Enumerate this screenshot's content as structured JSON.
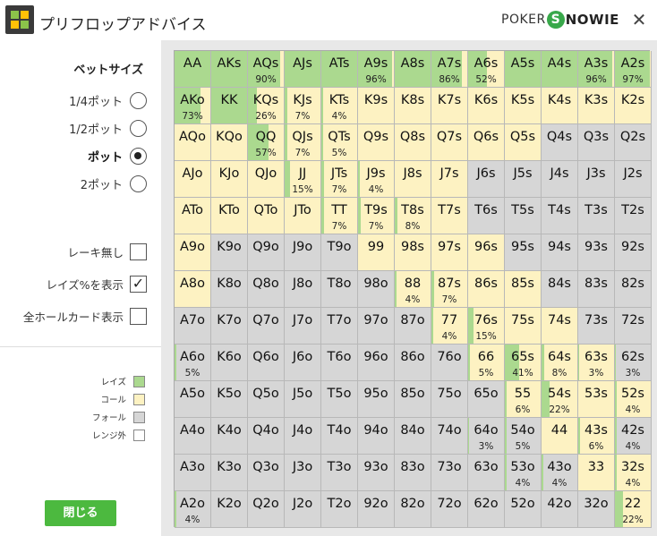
{
  "window": {
    "title": "プリフロップアドバイス",
    "close_glyph": "✕"
  },
  "brand": {
    "poker": "POKER",
    "s": "S",
    "rest": "NOWIE"
  },
  "bet_size": {
    "heading": "ベットサイズ",
    "options": [
      {
        "label": "1/4ポット",
        "selected": false
      },
      {
        "label": "1/2ポット",
        "selected": false
      },
      {
        "label": "ポット",
        "selected": true
      },
      {
        "label": "2ポット",
        "selected": false
      }
    ]
  },
  "options": [
    {
      "label": "レーキ無し",
      "checked": false
    },
    {
      "label": "レイズ%を表示",
      "checked": true
    },
    {
      "label": "全ホールカード表示",
      "checked": false
    }
  ],
  "check_glyph": "✓",
  "legend": [
    {
      "label": "レイズ",
      "color": "#abd98f"
    },
    {
      "label": "コール",
      "color": "#fdf2c2"
    },
    {
      "label": "フォール",
      "color": "#d6d6d6"
    },
    {
      "label": "レンジ外",
      "color": "#ffffff"
    }
  ],
  "colors": {
    "raise": "#abd98f",
    "call": "#fdf2c2",
    "fold": "#d6d6d6",
    "close_button": "#4cb93f"
  },
  "close_button": "閉じる",
  "grid": [
    [
      {
        "h": "AA",
        "s": "R",
        "r": 100
      },
      {
        "h": "AKs",
        "s": "R",
        "r": 100
      },
      {
        "h": "AQs",
        "s": "C",
        "r": 90,
        "p": "90%"
      },
      {
        "h": "AJs",
        "s": "R",
        "r": 100
      },
      {
        "h": "ATs",
        "s": "R",
        "r": 100
      },
      {
        "h": "A9s",
        "s": "C",
        "r": 96,
        "p": "96%"
      },
      {
        "h": "A8s",
        "s": "R",
        "r": 100
      },
      {
        "h": "A7s",
        "s": "C",
        "r": 86,
        "p": "86%"
      },
      {
        "h": "A6s",
        "s": "C",
        "r": 52,
        "p": "52%"
      },
      {
        "h": "A5s",
        "s": "R",
        "r": 100
      },
      {
        "h": "A4s",
        "s": "R",
        "r": 100
      },
      {
        "h": "A3s",
        "s": "C",
        "r": 96,
        "p": "96%"
      },
      {
        "h": "A2s",
        "s": "C",
        "r": 97,
        "p": "97%"
      }
    ],
    [
      {
        "h": "AKo",
        "s": "C",
        "r": 73,
        "p": "73%"
      },
      {
        "h": "KK",
        "s": "R",
        "r": 100
      },
      {
        "h": "KQs",
        "s": "C",
        "r": 26,
        "p": "26%"
      },
      {
        "h": "KJs",
        "s": "C",
        "r": 7,
        "p": "7%"
      },
      {
        "h": "KTs",
        "s": "C",
        "r": 4,
        "p": "4%"
      },
      {
        "h": "K9s",
        "s": "C"
      },
      {
        "h": "K8s",
        "s": "C"
      },
      {
        "h": "K7s",
        "s": "C"
      },
      {
        "h": "K6s",
        "s": "C"
      },
      {
        "h": "K5s",
        "s": "C"
      },
      {
        "h": "K4s",
        "s": "C"
      },
      {
        "h": "K3s",
        "s": "C"
      },
      {
        "h": "K2s",
        "s": "C"
      }
    ],
    [
      {
        "h": "AQo",
        "s": "C"
      },
      {
        "h": "KQo",
        "s": "C"
      },
      {
        "h": "QQ",
        "s": "C",
        "r": 57,
        "p": "57%"
      },
      {
        "h": "QJs",
        "s": "C",
        "r": 7,
        "p": "7%"
      },
      {
        "h": "QTs",
        "s": "C",
        "r": 5,
        "p": "5%"
      },
      {
        "h": "Q9s",
        "s": "C"
      },
      {
        "h": "Q8s",
        "s": "C"
      },
      {
        "h": "Q7s",
        "s": "C"
      },
      {
        "h": "Q6s",
        "s": "C"
      },
      {
        "h": "Q5s",
        "s": "C"
      },
      {
        "h": "Q4s",
        "s": "F"
      },
      {
        "h": "Q3s",
        "s": "F"
      },
      {
        "h": "Q2s",
        "s": "F"
      }
    ],
    [
      {
        "h": "AJo",
        "s": "C"
      },
      {
        "h": "KJo",
        "s": "C"
      },
      {
        "h": "QJo",
        "s": "C"
      },
      {
        "h": "JJ",
        "s": "C",
        "r": 15,
        "p": "15%"
      },
      {
        "h": "JTs",
        "s": "C",
        "r": 7,
        "p": "7%"
      },
      {
        "h": "J9s",
        "s": "C",
        "r": 4,
        "p": "4%"
      },
      {
        "h": "J8s",
        "s": "C"
      },
      {
        "h": "J7s",
        "s": "C"
      },
      {
        "h": "J6s",
        "s": "F"
      },
      {
        "h": "J5s",
        "s": "F"
      },
      {
        "h": "J4s",
        "s": "F"
      },
      {
        "h": "J3s",
        "s": "F"
      },
      {
        "h": "J2s",
        "s": "F"
      }
    ],
    [
      {
        "h": "ATo",
        "s": "C"
      },
      {
        "h": "KTo",
        "s": "C"
      },
      {
        "h": "QTo",
        "s": "C"
      },
      {
        "h": "JTo",
        "s": "C"
      },
      {
        "h": "TT",
        "s": "C",
        "r": 7,
        "p": "7%"
      },
      {
        "h": "T9s",
        "s": "C",
        "r": 7,
        "p": "7%"
      },
      {
        "h": "T8s",
        "s": "C",
        "r": 8,
        "p": "8%"
      },
      {
        "h": "T7s",
        "s": "C"
      },
      {
        "h": "T6s",
        "s": "F"
      },
      {
        "h": "T5s",
        "s": "F"
      },
      {
        "h": "T4s",
        "s": "F"
      },
      {
        "h": "T3s",
        "s": "F"
      },
      {
        "h": "T2s",
        "s": "F"
      }
    ],
    [
      {
        "h": "A9o",
        "s": "C"
      },
      {
        "h": "K9o",
        "s": "F"
      },
      {
        "h": "Q9o",
        "s": "F"
      },
      {
        "h": "J9o",
        "s": "F"
      },
      {
        "h": "T9o",
        "s": "F"
      },
      {
        "h": "99",
        "s": "C"
      },
      {
        "h": "98s",
        "s": "C"
      },
      {
        "h": "97s",
        "s": "C"
      },
      {
        "h": "96s",
        "s": "C"
      },
      {
        "h": "95s",
        "s": "F"
      },
      {
        "h": "94s",
        "s": "F"
      },
      {
        "h": "93s",
        "s": "F"
      },
      {
        "h": "92s",
        "s": "F"
      }
    ],
    [
      {
        "h": "A8o",
        "s": "C"
      },
      {
        "h": "K8o",
        "s": "F"
      },
      {
        "h": "Q8o",
        "s": "F"
      },
      {
        "h": "J8o",
        "s": "F"
      },
      {
        "h": "T8o",
        "s": "F"
      },
      {
        "h": "98o",
        "s": "F"
      },
      {
        "h": "88",
        "s": "C",
        "r": 4,
        "p": "4%"
      },
      {
        "h": "87s",
        "s": "C",
        "r": 7,
        "p": "7%"
      },
      {
        "h": "86s",
        "s": "C"
      },
      {
        "h": "85s",
        "s": "C"
      },
      {
        "h": "84s",
        "s": "F"
      },
      {
        "h": "83s",
        "s": "F"
      },
      {
        "h": "82s",
        "s": "F"
      }
    ],
    [
      {
        "h": "A7o",
        "s": "F"
      },
      {
        "h": "K7o",
        "s": "F"
      },
      {
        "h": "Q7o",
        "s": "F"
      },
      {
        "h": "J7o",
        "s": "F"
      },
      {
        "h": "T7o",
        "s": "F"
      },
      {
        "h": "97o",
        "s": "F"
      },
      {
        "h": "87o",
        "s": "F"
      },
      {
        "h": "77",
        "s": "C",
        "r": 4,
        "p": "4%"
      },
      {
        "h": "76s",
        "s": "C",
        "r": 15,
        "p": "15%"
      },
      {
        "h": "75s",
        "s": "C"
      },
      {
        "h": "74s",
        "s": "C"
      },
      {
        "h": "73s",
        "s": "F"
      },
      {
        "h": "72s",
        "s": "F"
      }
    ],
    [
      {
        "h": "A6o",
        "s": "F",
        "r": 5,
        "p": "5%"
      },
      {
        "h": "K6o",
        "s": "F"
      },
      {
        "h": "Q6o",
        "s": "F"
      },
      {
        "h": "J6o",
        "s": "F"
      },
      {
        "h": "T6o",
        "s": "F"
      },
      {
        "h": "96o",
        "s": "F"
      },
      {
        "h": "86o",
        "s": "F"
      },
      {
        "h": "76o",
        "s": "F"
      },
      {
        "h": "66",
        "s": "C",
        "r": 5,
        "p": "5%"
      },
      {
        "h": "65s",
        "s": "C",
        "r": 41,
        "p": "41%"
      },
      {
        "h": "64s",
        "s": "C",
        "r": 8,
        "p": "8%"
      },
      {
        "h": "63s",
        "s": "C",
        "r": 3,
        "p": "3%"
      },
      {
        "h": "62s",
        "s": "F",
        "r": 3,
        "p": "3%"
      }
    ],
    [
      {
        "h": "A5o",
        "s": "F"
      },
      {
        "h": "K5o",
        "s": "F"
      },
      {
        "h": "Q5o",
        "s": "F"
      },
      {
        "h": "J5o",
        "s": "F"
      },
      {
        "h": "T5o",
        "s": "F"
      },
      {
        "h": "95o",
        "s": "F"
      },
      {
        "h": "85o",
        "s": "F"
      },
      {
        "h": "75o",
        "s": "F"
      },
      {
        "h": "65o",
        "s": "F"
      },
      {
        "h": "55",
        "s": "C",
        "r": 6,
        "p": "6%"
      },
      {
        "h": "54s",
        "s": "C",
        "r": 22,
        "p": "22%"
      },
      {
        "h": "53s",
        "s": "C"
      },
      {
        "h": "52s",
        "s": "C",
        "r": 4,
        "p": "4%"
      }
    ],
    [
      {
        "h": "A4o",
        "s": "F"
      },
      {
        "h": "K4o",
        "s": "F"
      },
      {
        "h": "Q4o",
        "s": "F"
      },
      {
        "h": "J4o",
        "s": "F"
      },
      {
        "h": "T4o",
        "s": "F"
      },
      {
        "h": "94o",
        "s": "F"
      },
      {
        "h": "84o",
        "s": "F"
      },
      {
        "h": "74o",
        "s": "F"
      },
      {
        "h": "64o",
        "s": "F",
        "r": 3,
        "p": "3%"
      },
      {
        "h": "54o",
        "s": "F",
        "r": 5,
        "p": "5%"
      },
      {
        "h": "44",
        "s": "C"
      },
      {
        "h": "43s",
        "s": "C",
        "r": 6,
        "p": "6%"
      },
      {
        "h": "42s",
        "s": "F",
        "r": 4,
        "p": "4%"
      }
    ],
    [
      {
        "h": "A3o",
        "s": "F"
      },
      {
        "h": "K3o",
        "s": "F"
      },
      {
        "h": "Q3o",
        "s": "F"
      },
      {
        "h": "J3o",
        "s": "F"
      },
      {
        "h": "T3o",
        "s": "F"
      },
      {
        "h": "93o",
        "s": "F"
      },
      {
        "h": "83o",
        "s": "F"
      },
      {
        "h": "73o",
        "s": "F"
      },
      {
        "h": "63o",
        "s": "F"
      },
      {
        "h": "53o",
        "s": "F",
        "r": 4,
        "p": "4%"
      },
      {
        "h": "43o",
        "s": "F",
        "r": 4,
        "p": "4%"
      },
      {
        "h": "33",
        "s": "C"
      },
      {
        "h": "32s",
        "s": "C",
        "r": 4,
        "p": "4%"
      }
    ],
    [
      {
        "h": "A2o",
        "s": "F",
        "r": 4,
        "p": "4%"
      },
      {
        "h": "K2o",
        "s": "F"
      },
      {
        "h": "Q2o",
        "s": "F"
      },
      {
        "h": "J2o",
        "s": "F"
      },
      {
        "h": "T2o",
        "s": "F"
      },
      {
        "h": "92o",
        "s": "F"
      },
      {
        "h": "82o",
        "s": "F"
      },
      {
        "h": "72o",
        "s": "F"
      },
      {
        "h": "62o",
        "s": "F"
      },
      {
        "h": "52o",
        "s": "F"
      },
      {
        "h": "42o",
        "s": "F"
      },
      {
        "h": "32o",
        "s": "F"
      },
      {
        "h": "22",
        "s": "C",
        "r": 22,
        "p": "22%"
      }
    ]
  ]
}
